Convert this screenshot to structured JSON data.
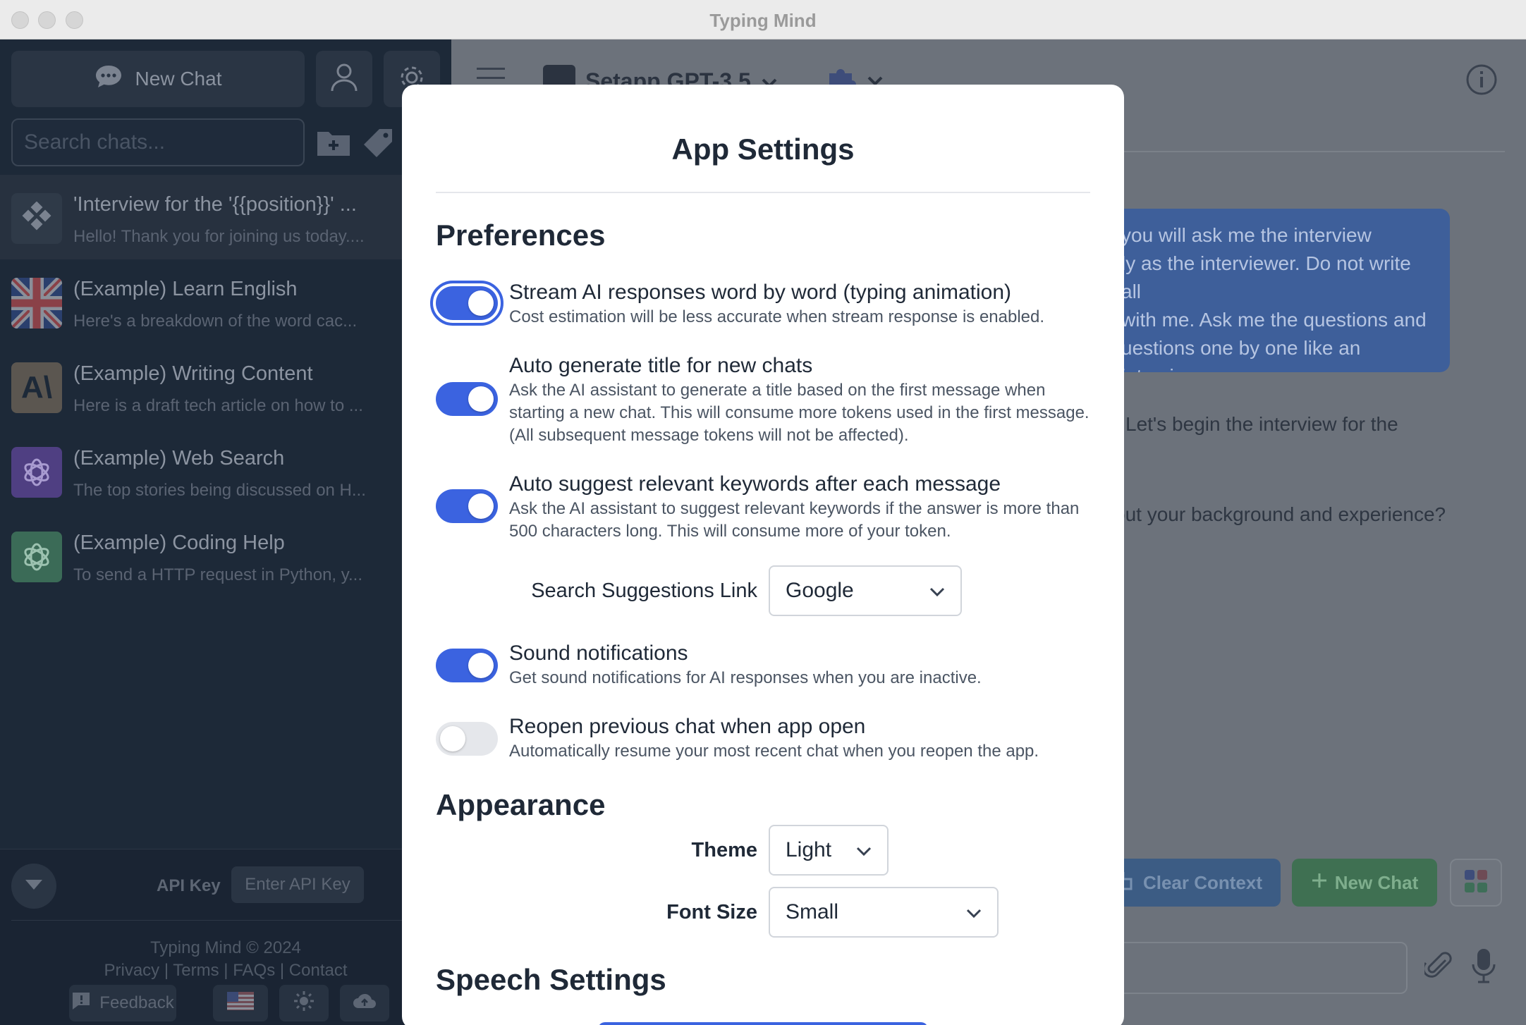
{
  "window": {
    "title": "Typing Mind"
  },
  "sidebar": {
    "new_chat_label": "New Chat",
    "search_placeholder": "Search chats...",
    "chats": [
      {
        "title": "'Interview for the '{{position}}' ...",
        "preview": "Hello! Thank you for joining us today....",
        "avatar": "setapp-logo",
        "active": true
      },
      {
        "title": "(Example) Learn English",
        "preview": "Here's a breakdown of the word cac...",
        "avatar": "uk-flag"
      },
      {
        "title": "(Example) Writing Content",
        "preview": "Here is a draft tech article on how to ...",
        "avatar": "anthropic-logo",
        "avatar_text": "A\\"
      },
      {
        "title": "(Example) Web Search",
        "preview": "The top stories being discussed on H...",
        "avatar": "openai-logo-purple"
      },
      {
        "title": "(Example) Coding Help",
        "preview": "To send a HTTP request in Python, y...",
        "avatar": "openai-logo-green"
      }
    ],
    "footer": {
      "api_key_label": "API Key",
      "api_key_button": "Enter API Key",
      "copyright": "Typing Mind © 2024",
      "links": "Privacy | Terms | FAQs | Contact",
      "feedback_label": "Feedback"
    }
  },
  "main": {
    "model_name": "Setapp GPT-3.5",
    "user_message_lines": [
      "you will ask me the interview",
      "ly as the interviewer. Do not write all",
      "with me. Ask me the questions and",
      "uestions one by one like an interviewer"
    ],
    "ai_line_1": "Let's begin the interview for the",
    "ai_line_2": "out your background and experience?",
    "clear_context_label": "Clear Context",
    "new_chat_label": "New Chat"
  },
  "modal": {
    "title": "App Settings",
    "preferences_title": "Preferences",
    "preferences": [
      {
        "label": "Stream AI responses word by word (typing animation)",
        "desc": "Cost estimation will be less accurate when stream response is enabled.",
        "enabled": true
      },
      {
        "label": "Auto generate title for new chats",
        "desc": "Ask the AI assistant to generate a title based on the first message when starting a new chat. This will consume more tokens used in the first message. (All subsequent message tokens will not be affected).",
        "enabled": true
      },
      {
        "label": "Auto suggest relevant keywords after each message",
        "desc": "Ask the AI assistant to suggest relevant keywords if the answer is more than 500 characters long. This will consume more of your token.",
        "enabled": true
      },
      {
        "label": "Sound notifications",
        "desc": "Get sound notifications for AI responses when you are inactive.",
        "enabled": true
      },
      {
        "label": "Reopen previous chat when app open",
        "desc": "Automatically resume your most recent chat when you reopen the app.",
        "enabled": false
      }
    ],
    "search_suggestions": {
      "label": "Search Suggestions Link",
      "value": "Google"
    },
    "appearance_title": "Appearance",
    "theme": {
      "label": "Theme",
      "value": "Light"
    },
    "font_size": {
      "label": "Font Size",
      "value": "Small"
    },
    "speech_title": "Speech Settings"
  },
  "colors": {
    "accent": "#3b63e0",
    "sidebar_bg": "#1d2938",
    "toggle_off": "#e5e7eb"
  }
}
